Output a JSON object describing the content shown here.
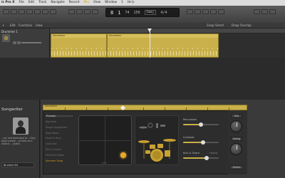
{
  "menubar": {
    "app": "ic Pro X",
    "items": [
      "File",
      "Edit",
      "Track",
      "Navigate",
      "Record",
      "Mix",
      "View",
      "Window",
      "1",
      "Help"
    ],
    "active": "Mix"
  },
  "window": {
    "title": "Untitled - Tracks"
  },
  "transport": {
    "bar": "8",
    "beat": "1",
    "tempo": "74",
    "bpm": "150",
    "key": "Cmaj",
    "sig": "4/4"
  },
  "tracks_toolbar": {
    "edit": "Edit",
    "functions": "Functions",
    "view": "View",
    "snap": "Snap:",
    "snap_value": "Smart",
    "drag": "Drag:",
    "drag_value": "Overlap"
  },
  "track": {
    "name": "Drummer 1"
  },
  "regions": [
    {
      "label": "Drummer"
    },
    {
      "label": "Drummer"
    }
  ],
  "sidebar": {
    "title": "Songwriter",
    "blurb": "...ed, and dedicated to ...Gary plays simple ...at feels as a natural ... guitar.",
    "kit": "Bluebird Kit"
  },
  "editor": {
    "region_label": "Drummer",
    "preset_header": "Presets",
    "presets": [
      "Pop Rock",
      "Singer-Songwriter",
      "Slow Wave",
      "Heart & Soul",
      "Cool Dad",
      "Kick & Snare",
      "Half-Time Vibes",
      "Summer Song"
    ],
    "selected_preset": "Summer Song",
    "xy_label": "Soft",
    "section_percussion": "Percussion",
    "section_kick_snare": "Kick & Snare",
    "section_cymbals": "Cymbals",
    "follow": "Follow",
    "fills_label": "Fills",
    "swing_label": "Swing",
    "details_label": "Details",
    "percussion_level": 0.5,
    "cymbals_level": 0.55,
    "kick_level": 0.65
  }
}
